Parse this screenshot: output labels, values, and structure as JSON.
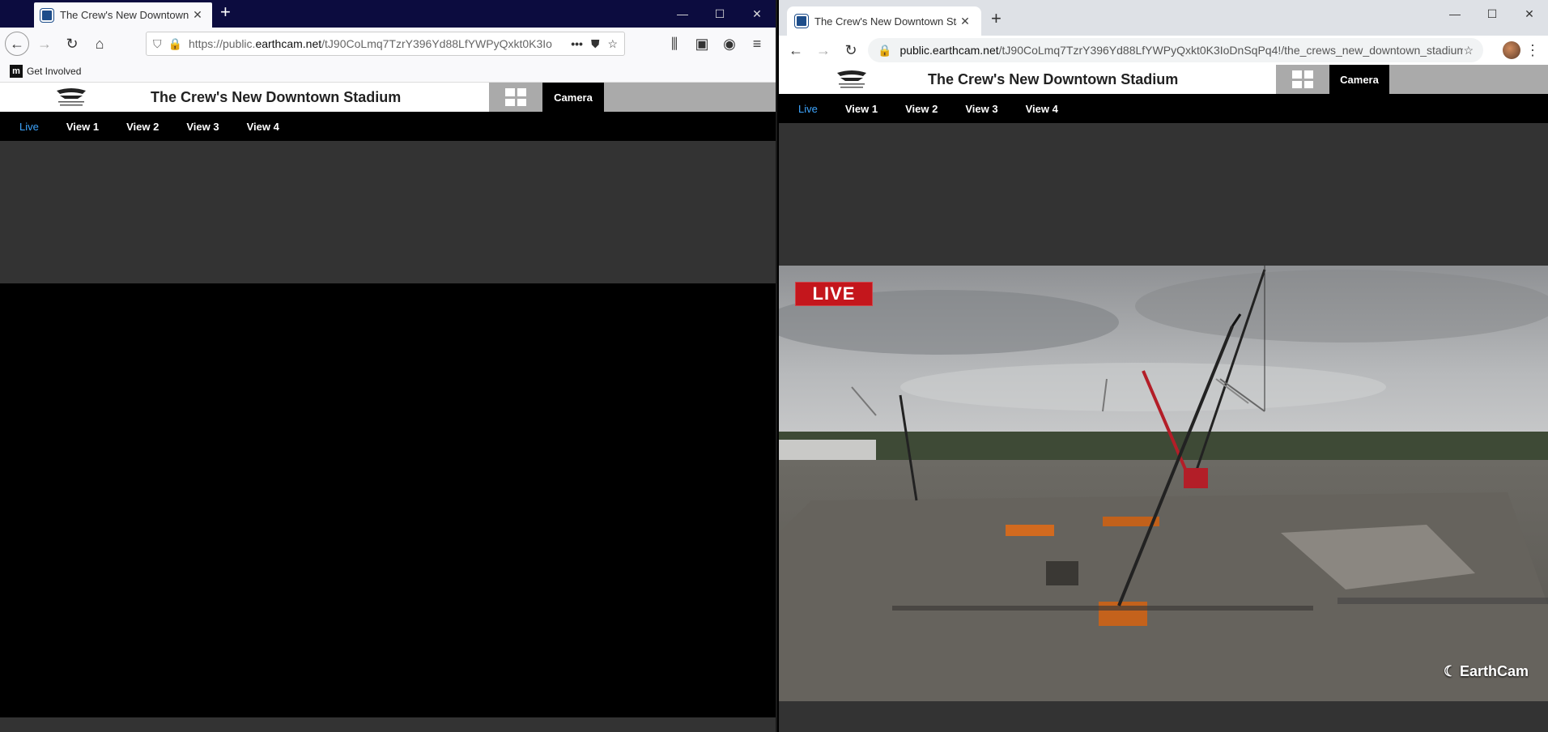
{
  "left_window": {
    "tab_title": "The Crew's New Downtown Sta",
    "url_prefix": "https://public.",
    "url_domain": "earthcam.net",
    "url_rest": "/tJ90CoLmq7TzrY396Yd88LfYWPyQxkt0K3Io",
    "bookmark": "Get Involved",
    "bookmark_icon_letter": "m"
  },
  "right_window": {
    "tab_title": "The Crew's New Downtown Stad",
    "url_domain": "public.earthcam.net",
    "url_rest": "/tJ90CoLmq7TzrY396Yd88LfYWPyQxkt0K3IoDnSqPq4!/the_crews_new_downtown_stadium/c..."
  },
  "page": {
    "title": "The Crew's New Downtown Stadium",
    "camera_label": "Camera",
    "nav": [
      "Live",
      "View 1",
      "View 2",
      "View 3",
      "View 4"
    ],
    "live_badge": "LIVE",
    "watermark": "EarthCam",
    "logo_text": "NEW CREW STADIUM"
  },
  "colors": {
    "accent_live": "#3ea6ff",
    "live_badge": "#c4161c"
  }
}
